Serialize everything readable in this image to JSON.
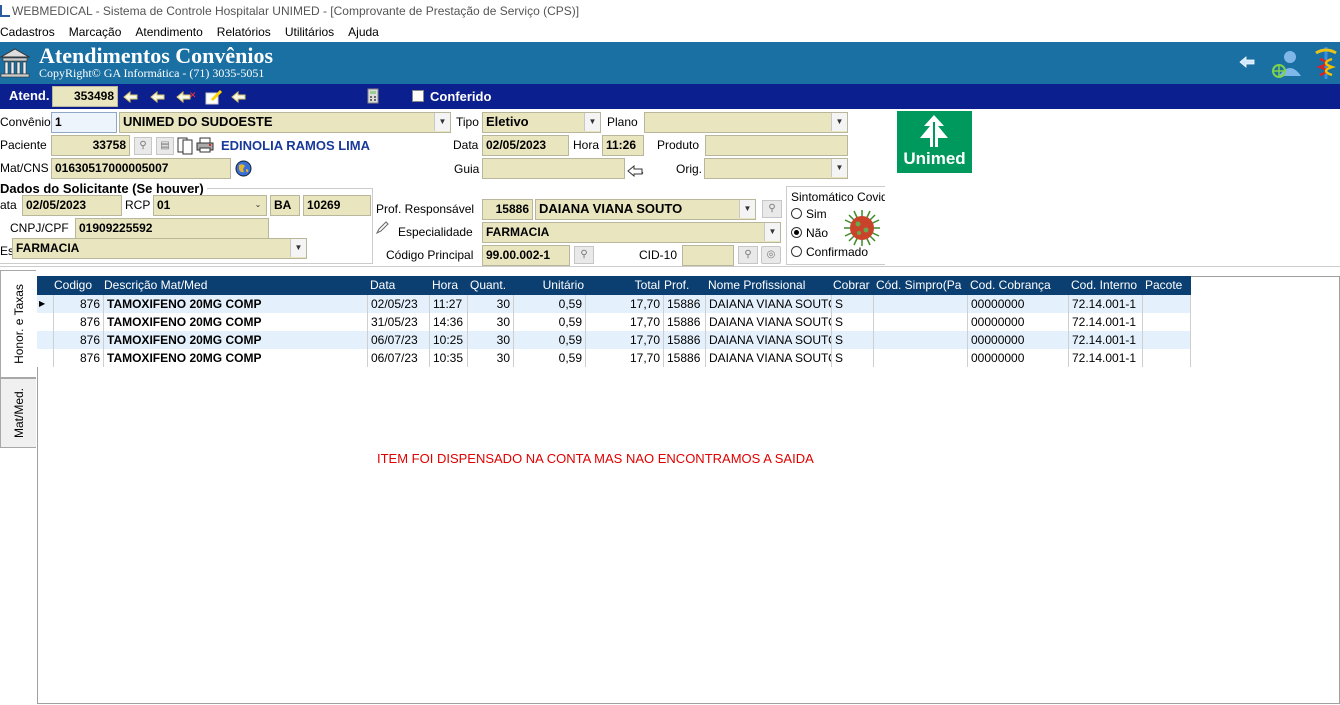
{
  "window_title": "WEBMEDICAL - Sistema de Controle Hospitalar UNIMED - [Comprovante de Prestação de Serviço  (CPS)]",
  "menu": [
    "Cadastros",
    "Marcação",
    "Atendimento",
    "Relatórios",
    "Utilitários",
    "Ajuda"
  ],
  "banner": {
    "title": "Atendimentos Convênios",
    "copyright": "CopyRight© GA Informática - (71) 3035-5051"
  },
  "toolbar": {
    "atend_label": "Atend.",
    "atend_value": "353498",
    "conferido_label": "Conferido"
  },
  "form": {
    "convenio_label": "Convênio",
    "convenio_code": "1",
    "convenio_name": "UNIMED DO SUDOESTE",
    "tipo_label": "Tipo",
    "tipo_value": "Eletivo",
    "plano_label": "Plano",
    "plano_value": "",
    "paciente_label": "Paciente",
    "paciente_code": "33758",
    "paciente_name": "EDINOLIA RAMOS LIMA",
    "data_label": "Data",
    "data_value": "02/05/2023",
    "hora_label": "Hora",
    "hora_value": "11:26",
    "produto_label": "Produto",
    "produto_value": "",
    "matcns_label": "Mat/CNS",
    "matcns_value": "01630517000005007",
    "guia_label": "Guia",
    "guia_value": "",
    "orig_label": "Orig.",
    "orig_value": "",
    "logo_text": "Unimed"
  },
  "solicitante": {
    "section_label": "Dados do Solicitante (Se houver)",
    "data_label": "ata",
    "data_value": "02/05/2023",
    "rcp_label": "RCP",
    "rcp_value": "01",
    "uf_value": "BA",
    "num_value": "10269",
    "cnpj_label": "CNPJ/CPF",
    "cnpj_value": "01909225592",
    "esp_label": "Es",
    "esp_value": "FARMACIA"
  },
  "profissional": {
    "resp_label": "Prof. Responsável",
    "resp_code": "15886",
    "resp_name": "DAIANA VIANA SOUTO",
    "esp_label": "Especialidade",
    "esp_value": "FARMACIA",
    "codigo_label": "Código Principal",
    "codigo_value": "99.00.002-1",
    "cid_label": "CID-10",
    "cid_value": ""
  },
  "covid": {
    "label": "Sintomático Covid",
    "options": [
      "Sim",
      "Não",
      "Confirmado"
    ],
    "selected": "Não"
  },
  "tabs": [
    "Honor. e Taxas",
    "Mat/Med."
  ],
  "table": {
    "columns": [
      "Codigo",
      "Descrição Mat/Med",
      "Data",
      "Hora",
      "Quant.",
      "Unitário",
      "Total",
      "Prof.",
      "Nome Profissional",
      "Cobrar",
      "Cód. Simpro(Pa",
      "Cod. Cobrança",
      "Cod. Interno",
      "Pacote"
    ],
    "rows": [
      [
        "876",
        "TAMOXIFENO 20MG COMP",
        "02/05/23",
        "11:27",
        "30",
        "0,59",
        "17,70",
        "15886",
        "DAIANA VIANA SOUTO",
        "S",
        "",
        "00000000",
        "72.14.001-1",
        ""
      ],
      [
        "876",
        "TAMOXIFENO 20MG COMP",
        "31/05/23",
        "14:36",
        "30",
        "0,59",
        "17,70",
        "15886",
        "DAIANA VIANA SOUTO",
        "S",
        "",
        "00000000",
        "72.14.001-1",
        ""
      ],
      [
        "876",
        "TAMOXIFENO 20MG COMP",
        "06/07/23",
        "10:25",
        "30",
        "0,59",
        "17,70",
        "15886",
        "DAIANA VIANA SOUTO",
        "S",
        "",
        "00000000",
        "72.14.001-1",
        ""
      ],
      [
        "876",
        "TAMOXIFENO 20MG COMP",
        "06/07/23",
        "10:35",
        "30",
        "0,59",
        "17,70",
        "15886",
        "DAIANA VIANA SOUTO",
        "S",
        "",
        "00000000",
        "72.14.001-1",
        ""
      ]
    ]
  },
  "note": "ITEM FOI DISPENSADO NA CONTA MAS NAO ENCONTRAMOS A SAIDA",
  "colors": {
    "banner": "#1a6fa3",
    "toolbar": "#0b1f8e",
    "grid_header": "#0b3f72",
    "field_bg": "#e8e5bf",
    "note": "#e00000",
    "unimed_green": "#00995d"
  }
}
